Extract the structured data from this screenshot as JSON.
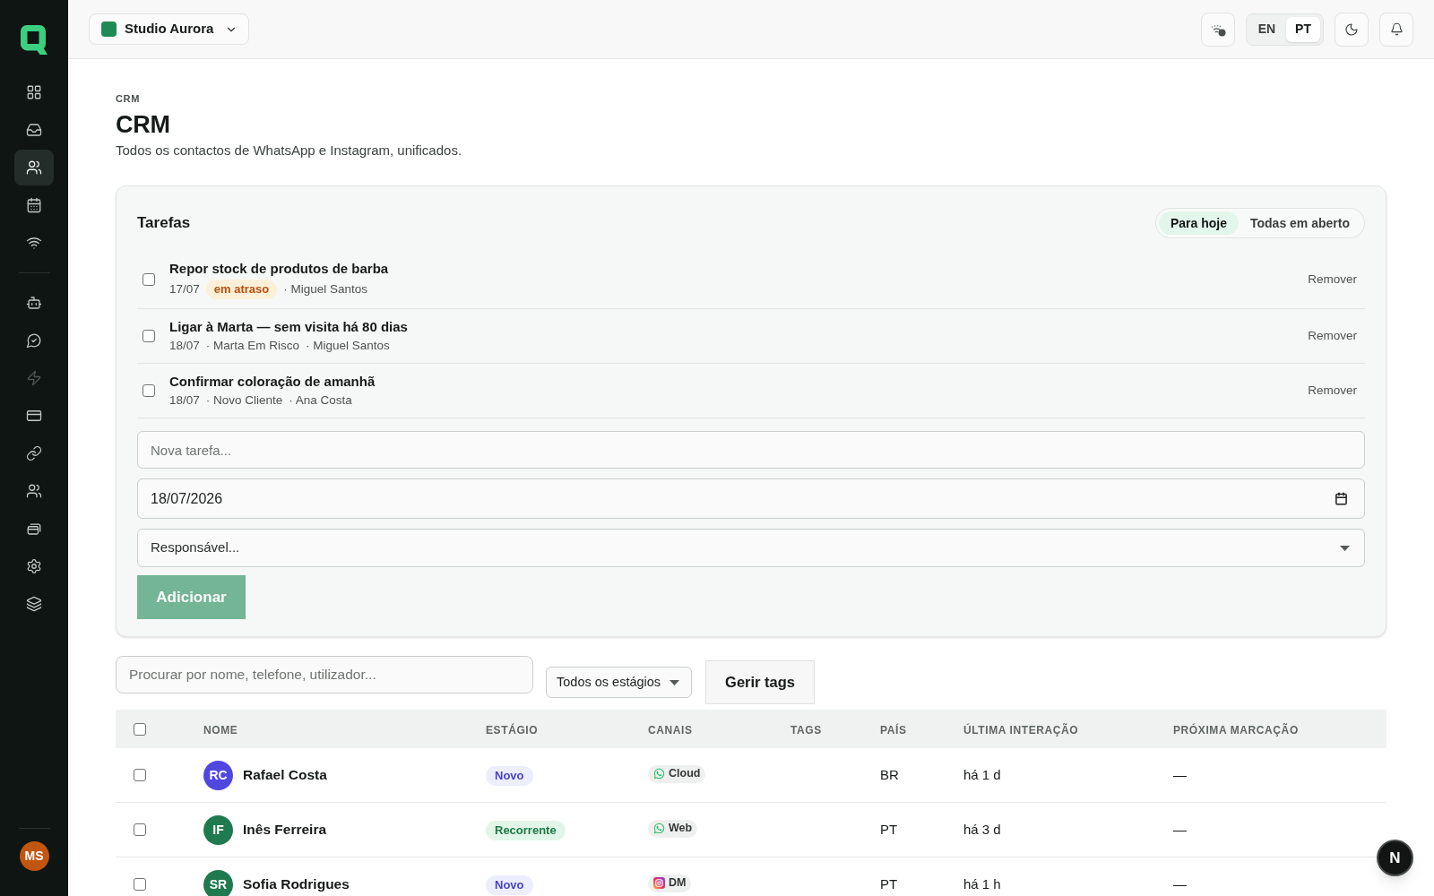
{
  "sidebar": {
    "primary_items": [
      {
        "selected": false,
        "disabled": false
      },
      {
        "selected": false,
        "disabled": false
      },
      {
        "selected": true,
        "disabled": false
      },
      {
        "selected": false,
        "disabled": false
      },
      {
        "selected": false,
        "disabled": false
      }
    ],
    "secondary_items": [
      {
        "selected": false,
        "disabled": false
      },
      {
        "selected": false,
        "disabled": false
      },
      {
        "selected": false,
        "disabled": true
      },
      {
        "selected": false,
        "disabled": false
      },
      {
        "selected": false,
        "disabled": false
      },
      {
        "selected": false,
        "disabled": false
      },
      {
        "selected": false,
        "disabled": false
      },
      {
        "selected": false,
        "disabled": false
      },
      {
        "selected": false,
        "disabled": false
      }
    ],
    "user": {
      "initials": "MS"
    }
  },
  "top_bar": {
    "workspace": {
      "name": "Studio Aurora"
    },
    "languages": [
      {
        "label": "EN",
        "selected": false
      },
      {
        "label": "PT",
        "selected": true
      }
    ]
  },
  "page": {
    "breadcrumb": "CRM",
    "title": "CRM",
    "subtitle": "Todos os contactos de WhatsApp e Instagram, unificados."
  },
  "tasks": {
    "title": "Tarefas",
    "filters": [
      {
        "label": "Para hoje",
        "selected": true
      },
      {
        "label": "Todas em aberto",
        "selected": false
      }
    ],
    "items": [
      {
        "checked": false,
        "title": "Repor stock de produtos de barba",
        "date": "17/07",
        "badge": "em atraso",
        "details": [
          "· Miguel Santos"
        ],
        "action": "Remover"
      },
      {
        "checked": false,
        "title": "Ligar à Marta — sem visita há 80 dias",
        "date": "18/07",
        "details": [
          "· Marta Em Risco",
          "· Miguel Santos"
        ],
        "action": "Remover"
      },
      {
        "checked": false,
        "title": "Confirmar coloração de amanhã",
        "date": "18/07",
        "details": [
          "· Novo Cliente",
          "· Ana Costa"
        ],
        "action": "Remover"
      }
    ],
    "form": {
      "task": {
        "placeholder": "Nova tarefa..."
      },
      "due_date": {
        "value": "18/07/2026"
      },
      "assignee": {
        "placeholder": "Responsável..."
      },
      "add_button": {
        "label": "Adicionar",
        "disabled": true
      }
    }
  },
  "filters": {
    "search": {
      "placeholder": "Procurar por nome, telefone, utilizador..."
    },
    "stage": {
      "value": "Todos os estágios"
    },
    "manage_tags": {
      "label": "Gerir tags"
    }
  },
  "table": {
    "select_all": {
      "checked": false
    },
    "columns": [
      "NOME",
      "ESTÁGIO",
      "CANAIS",
      "TAGS",
      "PAÍS",
      "ÚLTIMA INTERAÇÃO",
      "PRÓXIMA MARCAÇÃO"
    ],
    "rows": [
      {
        "checked": false,
        "avatar": {
          "initials": "RC",
          "color": "#5047e0"
        },
        "name": "Rafael Costa",
        "stage": {
          "kind": "new",
          "label": "Novo"
        },
        "channel": {
          "kind": "whatsapp",
          "label": "Cloud"
        },
        "country": "BR",
        "last_interaction": "há 1 d",
        "next_booking": "—"
      },
      {
        "checked": false,
        "avatar": {
          "initials": "IF",
          "color": "#1f7a4f"
        },
        "name": "Inês Ferreira",
        "stage": {
          "kind": "recurring",
          "label": "Recorrente"
        },
        "channel": {
          "kind": "whatsapp",
          "label": "Web"
        },
        "country": "PT",
        "last_interaction": "há 3 d",
        "next_booking": "—"
      },
      {
        "checked": false,
        "avatar": {
          "initials": "SR",
          "color": "#1f7a4f"
        },
        "name": "Sofia Rodrigues",
        "stage": {
          "kind": "new",
          "label": "Novo"
        },
        "channel": {
          "kind": "instagram",
          "label": "DM"
        },
        "country": "PT",
        "last_interaction": "há 1 h",
        "next_booking": "—"
      }
    ]
  },
  "dev_button": {
    "label": "N"
  }
}
